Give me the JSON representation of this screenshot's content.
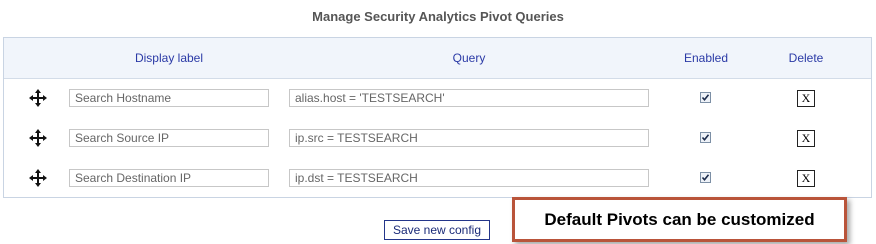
{
  "page": {
    "title": "Manage Security Analytics Pivot Queries"
  },
  "table": {
    "headers": {
      "display_label": "Display label",
      "query": "Query",
      "enabled": "Enabled",
      "delete": "Delete"
    },
    "rows": [
      {
        "label": "Search Hostname",
        "query": "alias.host = 'TESTSEARCH'",
        "enabled": true,
        "delete_label": "X"
      },
      {
        "label": "Search Source IP",
        "query": "ip.src = TESTSEARCH",
        "enabled": true,
        "delete_label": "X"
      },
      {
        "label": "Search Destination IP",
        "query": "ip.dst = TESTSEARCH",
        "enabled": true,
        "delete_label": "X"
      }
    ]
  },
  "actions": {
    "save_label": "Save new config"
  },
  "callout": {
    "text": "Default Pivots can be customized"
  },
  "colors": {
    "header_text": "#2b3aa6",
    "header_bg": "#f1f5fb",
    "callout_border": "#b9543a"
  },
  "icons": {
    "drag_handle": "move-icon",
    "checkbox_check": "check-icon"
  }
}
